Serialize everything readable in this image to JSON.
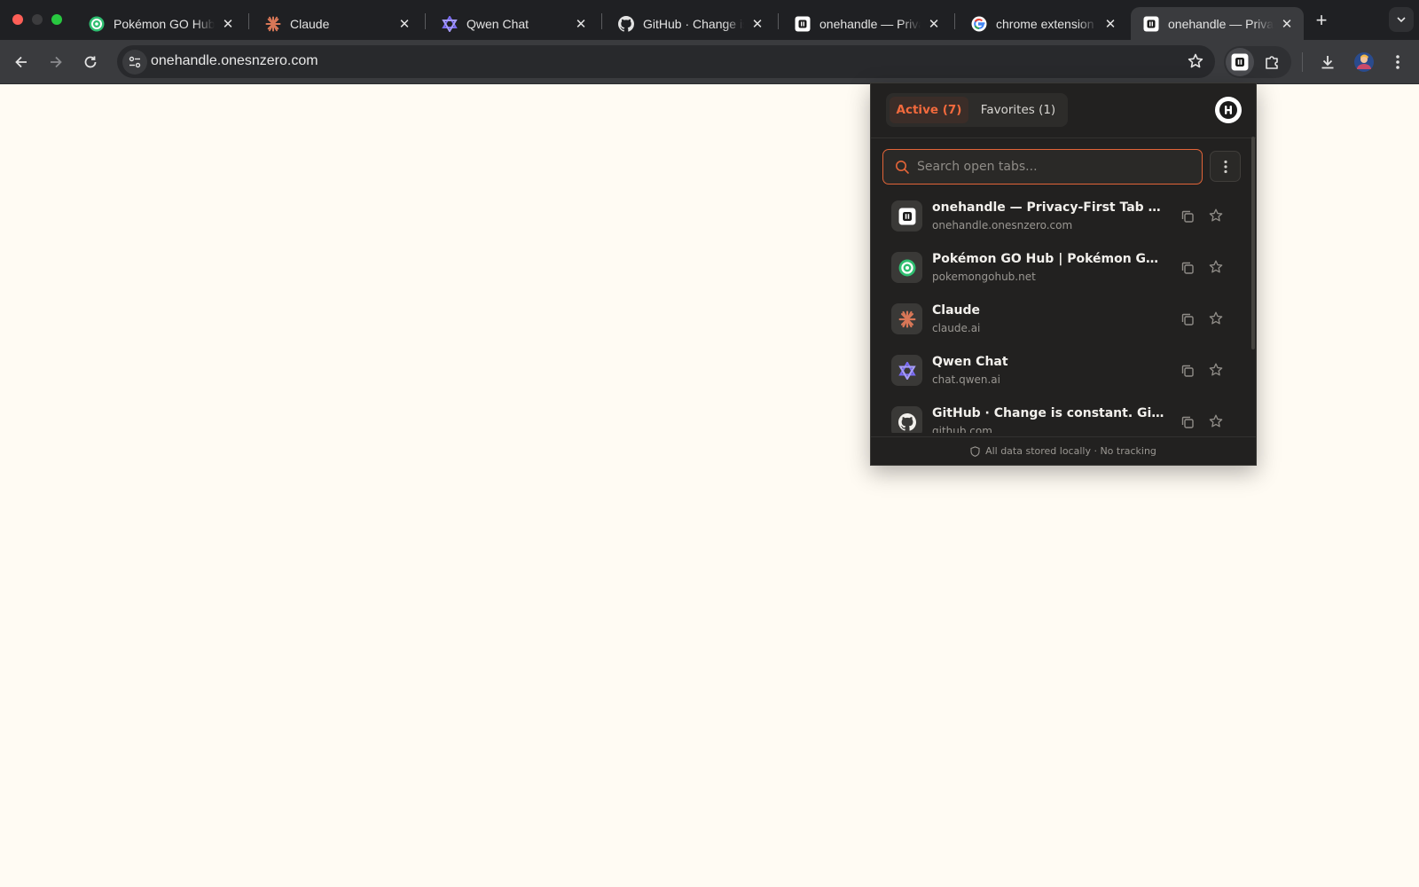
{
  "browser": {
    "tabs": [
      {
        "title": "Pokémon GO Hub |",
        "favicon": "pokemon-go-hub-icon"
      },
      {
        "title": "Claude",
        "favicon": "claude-icon"
      },
      {
        "title": "Qwen Chat",
        "favicon": "qwen-icon"
      },
      {
        "title": "GitHub · Change is",
        "favicon": "github-icon"
      },
      {
        "title": "onehandle — Privac",
        "favicon": "onehandle-icon"
      },
      {
        "title": "chrome extension -",
        "favicon": "google-icon"
      },
      {
        "title": "onehandle — Privac",
        "favicon": "onehandle-icon",
        "active": true
      }
    ],
    "url": "onehandle.onesnzero.com"
  },
  "popup": {
    "tab_active_label": "Active (7)",
    "tab_favorites_label": "Favorites (1)",
    "search_placeholder": "Search open tabs...",
    "items": [
      {
        "title": "onehandle — Privacy-First Tab Manager",
        "domain": "onehandle.onesnzero.com",
        "icon": "onehandle-icon"
      },
      {
        "title": "Pokémon GO Hub | Pokémon GO News",
        "domain": "pokemongohub.net",
        "icon": "pokemon-go-hub-icon"
      },
      {
        "title": "Claude",
        "domain": "claude.ai",
        "icon": "claude-icon"
      },
      {
        "title": "Qwen Chat",
        "domain": "chat.qwen.ai",
        "icon": "qwen-icon"
      },
      {
        "title": "GitHub · Change is constant. GitHub keeps you ahead",
        "domain": "github.com",
        "icon": "github-icon"
      }
    ],
    "footer": "All data stored locally · No tracking"
  },
  "colors": {
    "accent": "#f26a3d",
    "popup_bg": "#222120",
    "page_bg": "#fffbf3"
  }
}
